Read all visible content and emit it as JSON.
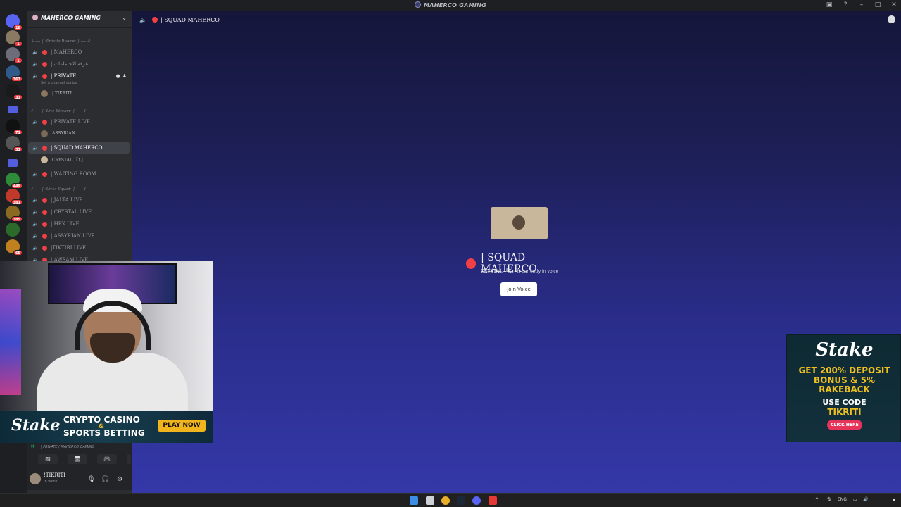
{
  "window": {
    "title": "MAHERCO GAMING"
  },
  "rail": {
    "badges": [
      "18",
      "1",
      "1",
      "363",
      "33",
      "71",
      "31",
      "449",
      "381",
      "385",
      "65"
    ]
  },
  "sidebar": {
    "server_name": "MAHERCO GAMING",
    "categories": {
      "private": "⊱ ── { ·Private Rooms· } ── ⊰",
      "live": "⊱ ── { ·Live Stream· } ── ⊰",
      "squad": "⊱ ── { ·Lives Squad· } ── ⊰"
    },
    "channels": {
      "maherco": "| MAHERCO",
      "meeting": "| غرفة الاجتماعات",
      "private": "| PRIVATE",
      "private_status": "Set a channel status",
      "private_member": "| TIKRITI",
      "private_live": "| PRIVATE LIVE",
      "private_live_member": "ASSYRIAN",
      "squad_maherco": "| SQUAD MAHERCO",
      "squad_member": "CRYSTAL 『X』",
      "waiting_room": "| WAITING ROOM",
      "jalta": "| JALTA LIVE",
      "crystal": "| CRYSTAL LIVE",
      "hex": "| HEX LIVE",
      "assyrian": "| ASSYRIAN LIVE",
      "tiktiri": "|TIKTIRI LIVE",
      "awsam": "| AWSAM LIVE"
    }
  },
  "voice_panel": {
    "channel_text": "| PRIVATE / MAHERCO GAMING"
  },
  "user_panel": {
    "username": "!TIKRITI",
    "status": "In voice"
  },
  "main": {
    "header_channel": "| SQUAD MAHERCO",
    "channel_title": "| SQUAD MAHERCO",
    "in_voice_user": "CRYSTAL 『X』",
    "in_voice_text": "is currently in voice",
    "join_button": "Join Voice"
  },
  "ad_bottom": {
    "logo": "Stake",
    "line1": "CRYPTO CASINO",
    "amp": "&",
    "line2": "SPORTS BETTING",
    "button": "PLAY NOW"
  },
  "ad_right": {
    "logo": "Stake",
    "line1": "GET 200% DEPOSIT",
    "line2": "BONUS & 5%",
    "line3": "RAKEBACK",
    "line4": "USE CODE",
    "line5": "TIKRITI",
    "button": "CLICK HERE"
  },
  "taskbar": {
    "lang": "ENG"
  }
}
